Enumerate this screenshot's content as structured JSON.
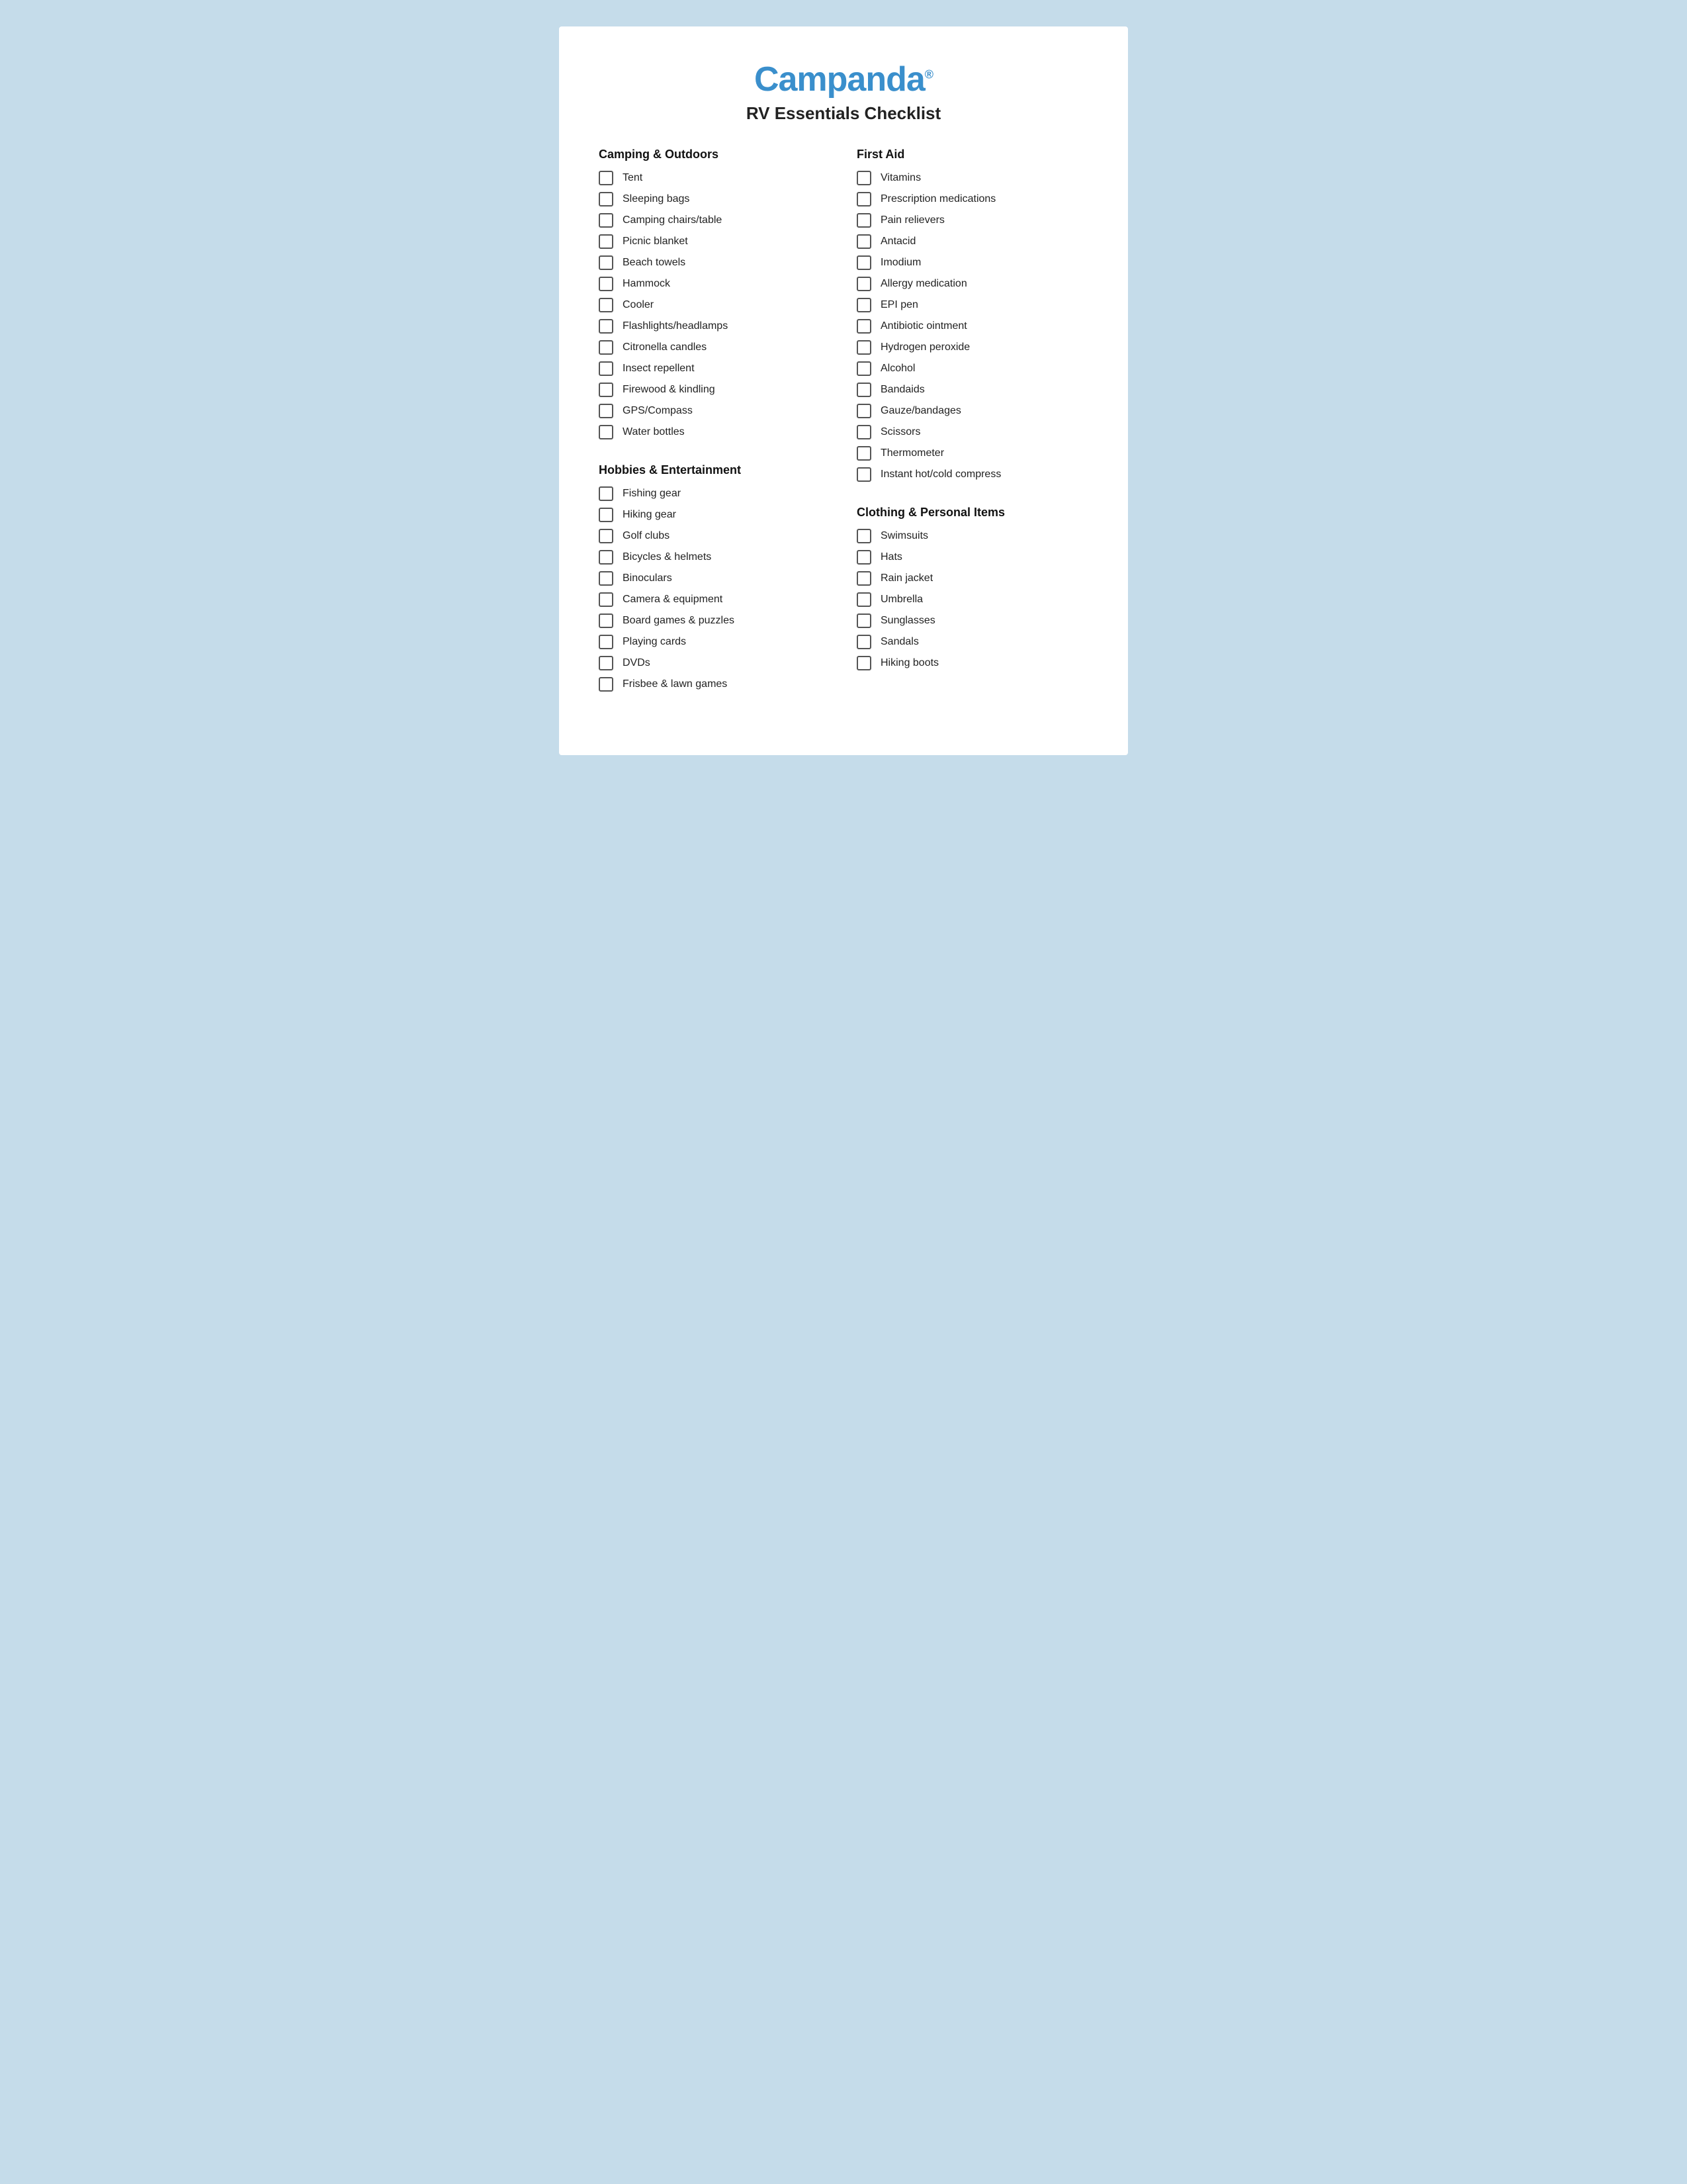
{
  "header": {
    "logo": "Campanda",
    "logo_sup": "®",
    "title": "RV Essentials Checklist"
  },
  "left_column": {
    "sections": [
      {
        "id": "camping-outdoors",
        "title": "Camping & Outdoors",
        "items": [
          "Tent",
          "Sleeping bags",
          "Camping chairs/table",
          "Picnic blanket",
          "Beach towels",
          "Hammock",
          "Cooler",
          "Flashlights/headlamps",
          "Citronella candles",
          "Insect repellent",
          "Firewood & kindling",
          "GPS/Compass",
          "Water bottles"
        ]
      },
      {
        "id": "hobbies-entertainment",
        "title": "Hobbies & Entertainment",
        "items": [
          "Fishing gear",
          "Hiking gear",
          "Golf clubs",
          "Bicycles & helmets",
          "Binoculars",
          "Camera & equipment",
          "Board games & puzzles",
          "Playing cards",
          "DVDs",
          "Frisbee & lawn games"
        ]
      }
    ]
  },
  "right_column": {
    "sections": [
      {
        "id": "first-aid",
        "title": "First Aid",
        "items": [
          "Vitamins",
          "Prescription medications",
          "Pain relievers",
          "Antacid",
          "Imodium",
          "Allergy medication",
          "EPI pen",
          "Antibiotic ointment",
          "Hydrogen peroxide",
          "Alcohol",
          "Bandaids",
          "Gauze/bandages",
          "Scissors",
          "Thermometer",
          "Instant hot/cold compress"
        ]
      },
      {
        "id": "clothing-personal",
        "title": "Clothing & Personal Items",
        "items": [
          "Swimsuits",
          "Hats",
          "Rain jacket",
          "Umbrella",
          "Sunglasses",
          "Sandals",
          "Hiking boots"
        ]
      }
    ]
  }
}
